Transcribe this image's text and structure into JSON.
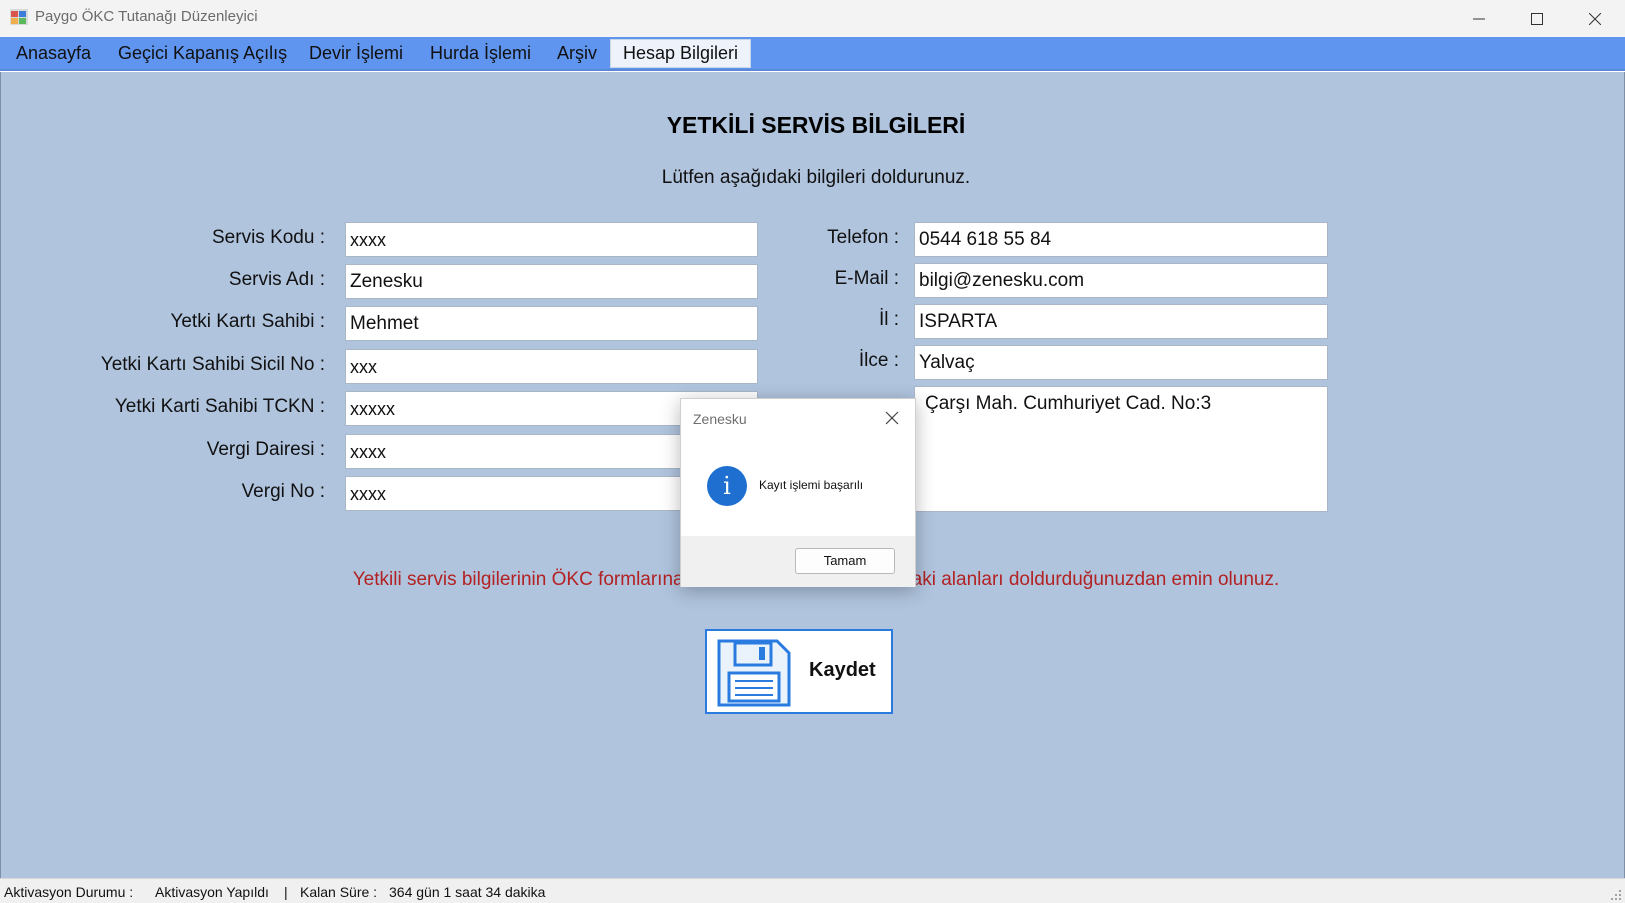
{
  "window": {
    "title": "Paygo ÖKC Tutanağı Düzenleyici"
  },
  "menu": {
    "items": [
      {
        "label": "Anasayfa"
      },
      {
        "label": "Geçici Kapanış Açılış"
      },
      {
        "label": "Devir İşlemi"
      },
      {
        "label": "Hurda İşlemi"
      },
      {
        "label": "Arşiv"
      },
      {
        "label": "Hesap Bilgileri",
        "active": true
      }
    ]
  },
  "form": {
    "heading": "YETKİLİ SERVİS BİLGİLERİ",
    "subheading": "Lütfen aşağıdaki bilgileri doldurunuz.",
    "left": [
      {
        "label": "Servis Kodu :",
        "value": "xxxx"
      },
      {
        "label": "Servis Adı :",
        "value": "Zenesku"
      },
      {
        "label": "Yetki Kartı Sahibi :",
        "value": "Mehmet"
      },
      {
        "label": "Yetki Kartı Sahibi Sicil No :",
        "value": "xxx"
      },
      {
        "label": "Yetki Karti Sahibi TCKN :",
        "value": "xxxxx"
      },
      {
        "label": "Vergi Dairesi :",
        "value": "xxxx"
      },
      {
        "label": "Vergi No :",
        "value": "xxxx"
      }
    ],
    "right": [
      {
        "label": "Telefon :",
        "value": "0544 618 55 84"
      },
      {
        "label": "E-Mail :",
        "value": "bilgi@zenesku.com"
      },
      {
        "label": "İl :",
        "value": "ISPARTA"
      },
      {
        "label": "İlce :",
        "value": "Yalvaç"
      }
    ],
    "address_value": "Çarşı Mah. Cumhuriyet Cad. No:3",
    "warning": "Yetkili servis bilgilerinin ÖKC formlarına oto                              aradaki alanları doldurduğunuzdan emin olunuz.",
    "save_label": "Kaydet"
  },
  "status": {
    "activation_label": "Aktivasyon Durumu :",
    "activation_value": "Aktivasyon Yapıldı",
    "separator": "|",
    "remaining_label": "Kalan Süre :",
    "remaining_value": "364 gün 1 saat 34 dakika"
  },
  "dialog": {
    "title": "Zenesku",
    "message": "Kayıt işlemi başarılı",
    "ok_label": "Tamam",
    "icon": "info-icon"
  },
  "colors": {
    "menu_bar": "#5f94ef",
    "panel": "#b0c4de",
    "warning": "#b22222",
    "accent": "#2a7be0"
  }
}
